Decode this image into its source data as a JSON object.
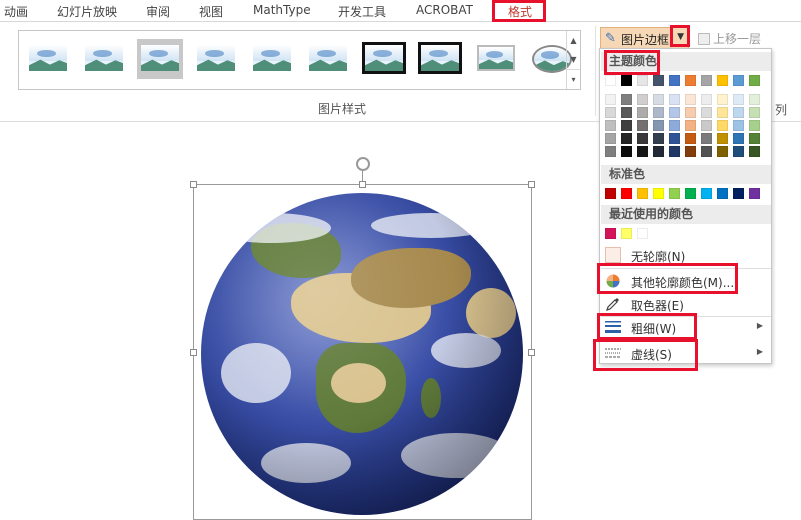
{
  "tabs": [
    {
      "label": "动画"
    },
    {
      "label": "幻灯片放映"
    },
    {
      "label": "审阅"
    },
    {
      "label": "视图"
    },
    {
      "label": "MathType"
    },
    {
      "label": "开发工具"
    },
    {
      "label": "ACROBAT"
    },
    {
      "label": "格式"
    }
  ],
  "ribbon": {
    "group_label": "图片样式",
    "border_button_label": "图片边框",
    "move_up_label": "上移一层",
    "cut_off_label": "列",
    "picture_style_icons": [
      "simple-frame-white",
      "soft-edge",
      "drop-shadow",
      "reflected",
      "reflected-rounded",
      "soft-reflected",
      "thick-black-frame",
      "black-matte",
      "bevel-frame",
      "oval"
    ]
  },
  "menu": {
    "theme_colors_label": "主题颜色",
    "standard_colors_label": "标准色",
    "recent_colors_label": "最近使用的颜色",
    "no_outline_label": "无轮廓(N)",
    "more_colors_label": "其他轮廓颜色(M)...",
    "eyedropper_label": "取色器(E)",
    "weight_label": "粗细(W)",
    "dashes_label": "虚线(S)",
    "theme_top_row": [
      "#ffffff",
      "#000000",
      "#e7e6e6",
      "#44546a",
      "#4472c4",
      "#ed7d31",
      "#a5a5a5",
      "#ffc000",
      "#5b9bd5",
      "#70ad47"
    ],
    "theme_shades": [
      [
        "#f2f2f2",
        "#7f7f7f",
        "#d0cece",
        "#d6dce4",
        "#d9e2f3",
        "#fbe5d5",
        "#ededed",
        "#fff2cc",
        "#deebf6",
        "#e2efd9"
      ],
      [
        "#d8d8d8",
        "#595959",
        "#aeabab",
        "#adb9ca",
        "#b4c6e7",
        "#f7cbac",
        "#dbdbdb",
        "#fee599",
        "#bdd7ee",
        "#c5e0b3"
      ],
      [
        "#bfbfbf",
        "#3f3f3f",
        "#757070",
        "#8496b0",
        "#8eaadb",
        "#f4b183",
        "#c9c9c9",
        "#ffd965",
        "#9cc3e5",
        "#a8d08d"
      ],
      [
        "#a5a5a5",
        "#262626",
        "#3a3838",
        "#333f4f",
        "#2f5496",
        "#c55a11",
        "#7b7b7b",
        "#bf9000",
        "#2e75b5",
        "#538135"
      ],
      [
        "#7f7f7f",
        "#0c0c0c",
        "#171616",
        "#222a35",
        "#1f3864",
        "#833c0b",
        "#525252",
        "#7f6000",
        "#1e4e79",
        "#375623"
      ]
    ],
    "standard_colors": [
      "#c00000",
      "#ff0000",
      "#ffc000",
      "#ffff00",
      "#92d050",
      "#00b050",
      "#00b0f0",
      "#0070c0",
      "#002060",
      "#7030a0"
    ],
    "recent_colors": [
      "#d4145a",
      "#ffff66",
      "#ffffff"
    ]
  }
}
